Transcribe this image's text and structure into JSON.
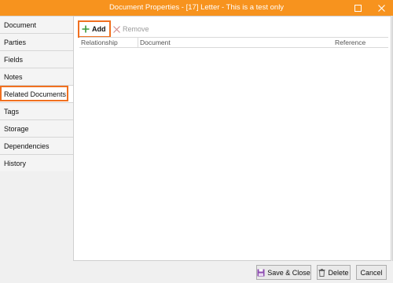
{
  "window": {
    "title": "Document Properties - [17] Letter - This is a test only"
  },
  "sidebar": {
    "items": [
      {
        "label": "Document"
      },
      {
        "label": "Parties"
      },
      {
        "label": "Fields"
      },
      {
        "label": "Notes"
      },
      {
        "label": "Related Documents"
      },
      {
        "label": "Tags"
      },
      {
        "label": "Storage"
      },
      {
        "label": "Dependencies"
      },
      {
        "label": "History"
      }
    ],
    "selected": "Related Documents"
  },
  "toolbar": {
    "add_label": "Add",
    "remove_label": "Remove"
  },
  "grid": {
    "columns": [
      "Relationship",
      "Document",
      "Reference"
    ],
    "rows": []
  },
  "footer": {
    "save_close_label": "Save & Close",
    "delete_label": "Delete",
    "cancel_label": "Cancel"
  },
  "colors": {
    "titlebar": "#f7931e",
    "highlight": "#f07020"
  }
}
